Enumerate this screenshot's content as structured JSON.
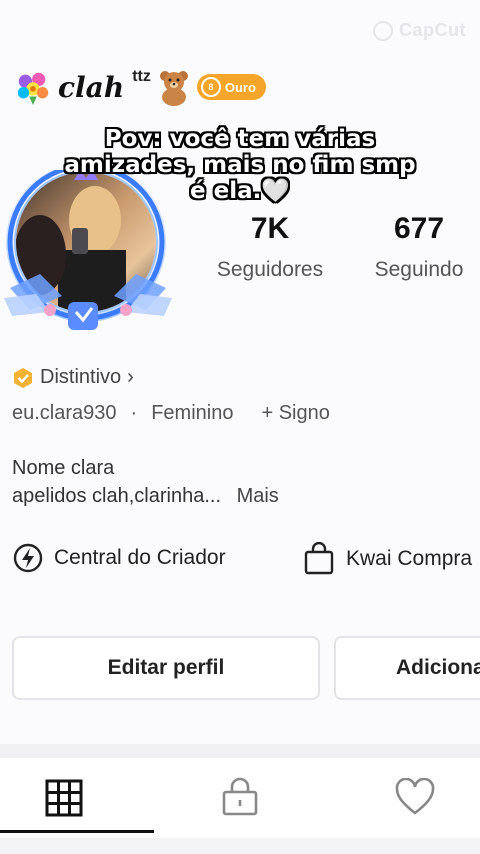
{
  "watermark": "CapCut",
  "profile": {
    "name": "clah",
    "name_suffix": "ttz",
    "level_badge": "Ouro"
  },
  "caption": {
    "line1": "Pov: você tem várias",
    "line2": "amizades, mais no fim smp",
    "line3": "é ela.🤍"
  },
  "stats": {
    "followers_value": "7K",
    "followers_label": "Seguidores",
    "following_value": "677",
    "following_label": "Seguindo"
  },
  "distintivo": {
    "label": "Distintivo",
    "chevron": "›"
  },
  "meta": {
    "username": "eu.clara930",
    "separator": "·",
    "gender": "Feminino",
    "sign": "+ Signo"
  },
  "bio": {
    "line1": "Nome clara",
    "line2": "apelidos clah,clarinha...",
    "more": "Mais"
  },
  "actions": {
    "creator_center": "Central do Criador",
    "kwai_shop": "Kwai Compra"
  },
  "buttons": {
    "edit_profile": "Editar perfil",
    "add": "Adiciona"
  },
  "tabs": [
    {
      "name": "grid",
      "icon": "grid-icon"
    },
    {
      "name": "private",
      "icon": "lock-icon"
    },
    {
      "name": "liked",
      "icon": "heart-icon"
    }
  ],
  "colors": {
    "gold_badge": "#f4a52a",
    "badge_icon": "#f2b233",
    "frame_blue": "#3a7bff"
  }
}
